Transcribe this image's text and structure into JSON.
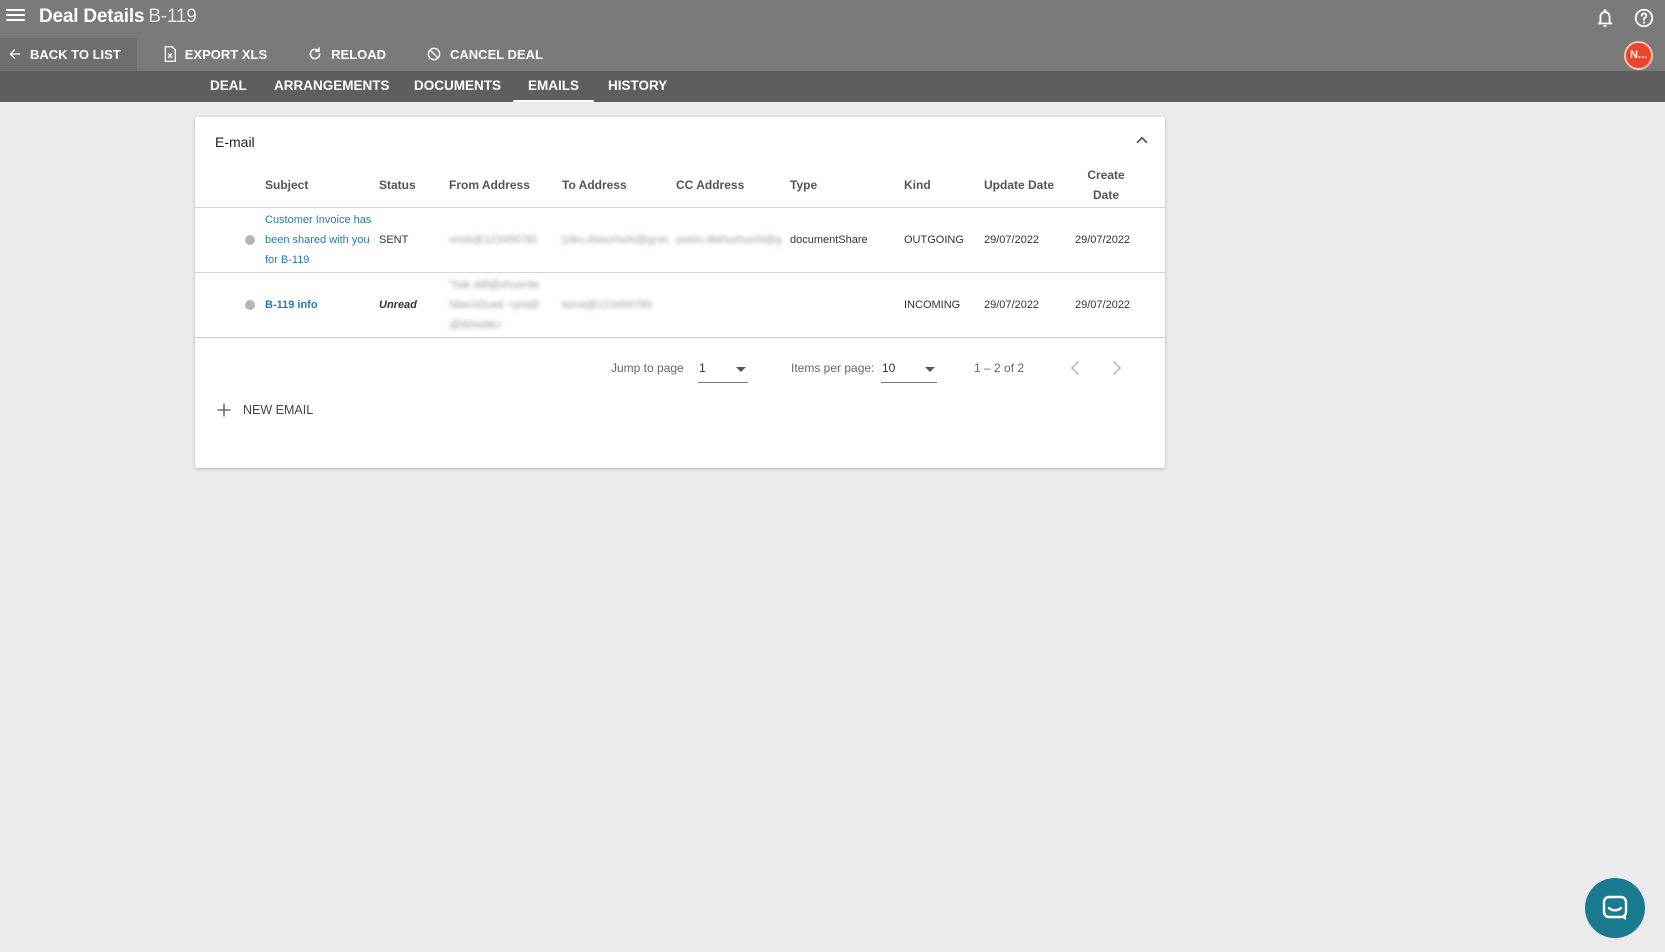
{
  "header": {
    "title": "Deal Details",
    "deal_id": "B-119",
    "avatar_initials": "N..."
  },
  "toolbar": {
    "back_label": "BACK TO LIST",
    "export_label": "EXPORT XLS",
    "reload_label": "RELOAD",
    "cancel_label": "CANCEL DEAL"
  },
  "tabs": [
    {
      "label": "DEAL"
    },
    {
      "label": "ARRANGEMENTS"
    },
    {
      "label": "DOCUMENTS"
    },
    {
      "label": "EMAILS"
    },
    {
      "label": "HISTORY"
    }
  ],
  "card": {
    "title": "E-mail"
  },
  "table": {
    "headers": {
      "subject": "Subject",
      "status": "Status",
      "from": "From Address",
      "to": "To Address",
      "cc": "CC Address",
      "type": "Type",
      "kind": "Kind",
      "update_date": "Update Date",
      "create_date": "Create Date"
    },
    "rows": [
      {
        "subject": "Customer Invoice has been shared with you for B-119",
        "status": "SENT",
        "from": "vriok@123456789",
        "to": "[vlku.dsburhuhi@grvn]",
        "cc": "prelm.dbthurhuchi@grvn",
        "type": "documentShare",
        "kind": "OUTGOING",
        "update_date": "29/07/2022",
        "create_date": "29/07/2022"
      },
      {
        "subject": "B-119 info",
        "status": "Unread",
        "from": "\"hak ddl@zhuerde Nbeck5ueb <prddl@tbheide>",
        "to": "tenvt@123456789",
        "cc": "",
        "type": "",
        "kind": "INCOMING",
        "update_date": "29/07/2022",
        "create_date": "29/07/2022"
      }
    ]
  },
  "pagination": {
    "jump_label": "Jump to page",
    "jump_value": "1",
    "items_label": "Items per page:",
    "items_value": "10",
    "range_label": "1 – 2 of 2"
  },
  "actions": {
    "new_email_label": "NEW EMAIL"
  },
  "colors": {
    "topbar": "#7a7a7a",
    "tabbar": "#5e5e5e",
    "link": "#2a78a8",
    "avatar": "#e8472a",
    "chat": "#1a7b90"
  }
}
